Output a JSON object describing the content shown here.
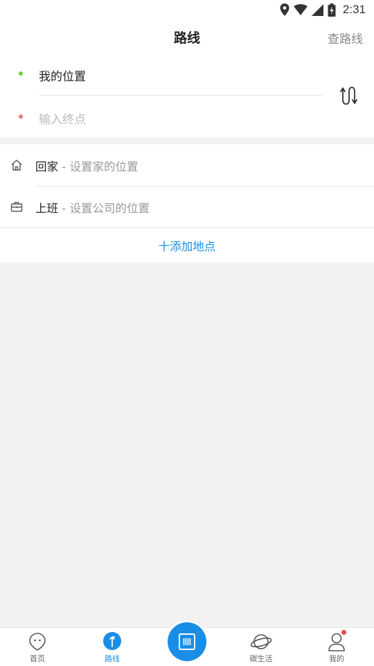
{
  "status_bar": {
    "time": "2:31"
  },
  "header": {
    "title": "路线",
    "action": "查路线"
  },
  "route": {
    "from": "我的位置",
    "to_placeholder": "输入终点"
  },
  "places": [
    {
      "name": "回家",
      "separator": " - ",
      "hint": "设置家的位置",
      "icon": "home-icon"
    },
    {
      "name": "上班",
      "separator": " - ",
      "hint": "设置公司的位置",
      "icon": "briefcase-icon"
    }
  ],
  "add_place": "十添加地点",
  "tabs": [
    {
      "label": "首页",
      "icon": "home-face-icon"
    },
    {
      "label": "路线",
      "icon": "route-icon",
      "active": true
    },
    {
      "label": "",
      "icon": "scan-icon"
    },
    {
      "label": "碳生活",
      "icon": "planet-icon"
    },
    {
      "label": "我的",
      "icon": "person-icon",
      "badge": true
    }
  ],
  "colors": {
    "accent": "#1a8ee6",
    "start_dot": "#6fcf3a",
    "end_dot": "#f2767a",
    "badge": "#f04848"
  }
}
